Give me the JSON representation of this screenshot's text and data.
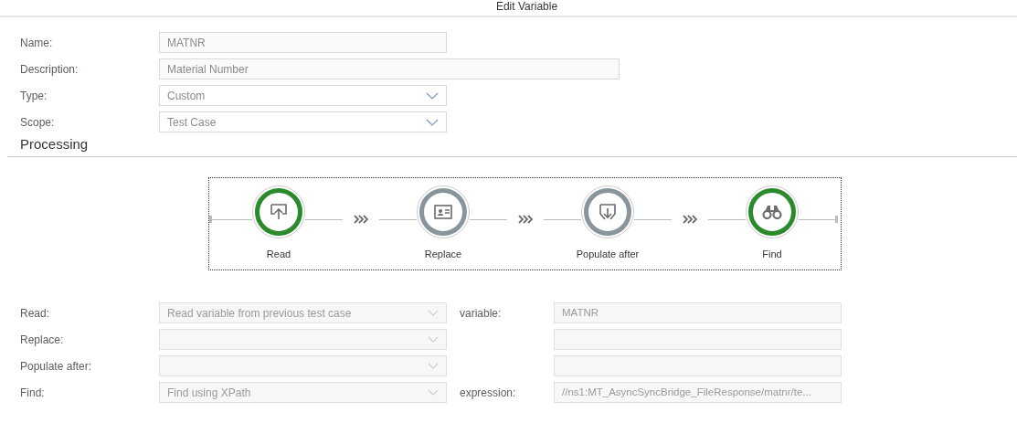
{
  "dialog_title": "Edit Variable",
  "fields": [
    {
      "label": "Name:",
      "value": "MATNR",
      "kind": "text",
      "wide": false
    },
    {
      "label": "Description:",
      "value": "Material Number",
      "kind": "text",
      "wide": true
    },
    {
      "label": "Type:",
      "value": "Custom",
      "kind": "select",
      "wide": false
    },
    {
      "label": "Scope:",
      "value": "Test Case",
      "kind": "select",
      "wide": false
    }
  ],
  "section_title": "Processing",
  "steps": [
    {
      "label": "Read",
      "kind": "upload",
      "color": "#2b8a2b"
    },
    {
      "label": "Replace",
      "kind": "card",
      "color": "#89959c"
    },
    {
      "label": "Populate after",
      "kind": "download",
      "color": "#89959c"
    },
    {
      "label": "Find",
      "kind": "binoculars",
      "color": "#2b8a2b"
    }
  ],
  "settings": [
    {
      "label": "Read:",
      "value": "Read variable from previous test case",
      "param_label": "variable:",
      "param_value": "MATNR"
    },
    {
      "label": "Replace:"
    },
    {
      "label": "Populate after:"
    },
    {
      "label": "Find:",
      "value": "Find using XPath",
      "param_label": "expression:",
      "param_value": "//ns1:MT_AsyncSyncBridge_FileResponse/matnr/te..."
    }
  ]
}
